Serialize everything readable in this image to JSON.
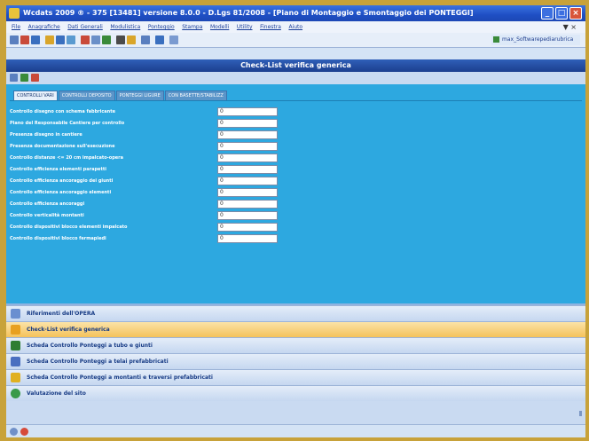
{
  "window": {
    "title": "Wcdats 2009 ® - 375 [13481] versione 8.0.0 - D.Lgs 81/2008 - [Piano di Montaggio e Smontaggio dei PONTEGGI]",
    "buttons": [
      "minimize",
      "maximize",
      "close"
    ]
  },
  "menubar": {
    "items": [
      "File",
      "Anagrafiche",
      "Dati Generali",
      "Modulistica",
      "Ponteggio",
      "Stampa",
      "Modelli",
      "Utility",
      "Finestra",
      "Aiuto"
    ],
    "right_icon": "▼ ×"
  },
  "toolbar": {
    "right_label": "max_Softwarepediarubrica"
  },
  "panel": {
    "title": "Check-List verifica generica"
  },
  "tabs": [
    {
      "label": "CONTROLLI VARI",
      "active": true
    },
    {
      "label": "CONTROLLI DEPOSITO",
      "active": false
    },
    {
      "label": "PONTEGGI LIGURE",
      "active": false
    },
    {
      "label": "CON BASETTE/STABILIZZ",
      "active": false
    }
  ],
  "checklist": [
    {
      "label": "Controllo disegno con schema fabbricante",
      "value": "0"
    },
    {
      "label": "Piano del Responsabile Cantiere per controllo",
      "value": "0"
    },
    {
      "label": "Presenza disegno in cantiere",
      "value": "0"
    },
    {
      "label": "Presenza documentazione sull'esecuzione",
      "value": "0"
    },
    {
      "label": "Controllo distanze <= 20 cm impalcato-opera",
      "value": "0"
    },
    {
      "label": "Controllo efficienza elementi parapetti",
      "value": "0"
    },
    {
      "label": "Controllo efficienza ancoraggio dei giunti",
      "value": "0"
    },
    {
      "label": "Controllo efficienza ancoraggio elementi",
      "value": "0"
    },
    {
      "label": "Controllo efficienza ancoraggi",
      "value": "0"
    },
    {
      "label": "Controllo verticalità montanti",
      "value": "0"
    },
    {
      "label": "Controllo dispositivi blocco elementi impalcato",
      "value": "0"
    },
    {
      "label": "Controllo dispositivi blocco fermapiedi",
      "value": "0"
    }
  ],
  "nav": [
    {
      "label": "Riferimenti dell'OPERA",
      "active": false,
      "icon": "document-icon",
      "color": "#6a8fd0"
    },
    {
      "label": "Check-List verifica generica",
      "active": true,
      "icon": "checklist-icon",
      "color": "#e8a020"
    },
    {
      "label": "Scheda Controllo Ponteggi a tubo e giunti",
      "active": false,
      "icon": "scaffold-icon",
      "color": "#2e7d32"
    },
    {
      "label": "Scheda Controllo Ponteggi a telai prefabbricati",
      "active": false,
      "icon": "frame-icon",
      "color": "#4a6fc0"
    },
    {
      "label": "Scheda Controllo Ponteggi a montanti e traversi prefabbricati",
      "active": false,
      "icon": "pole-icon",
      "color": "#e0b020"
    },
    {
      "label": "Valutazione del sito",
      "active": false,
      "icon": "globe-icon",
      "color": "#3a9a4a"
    }
  ]
}
